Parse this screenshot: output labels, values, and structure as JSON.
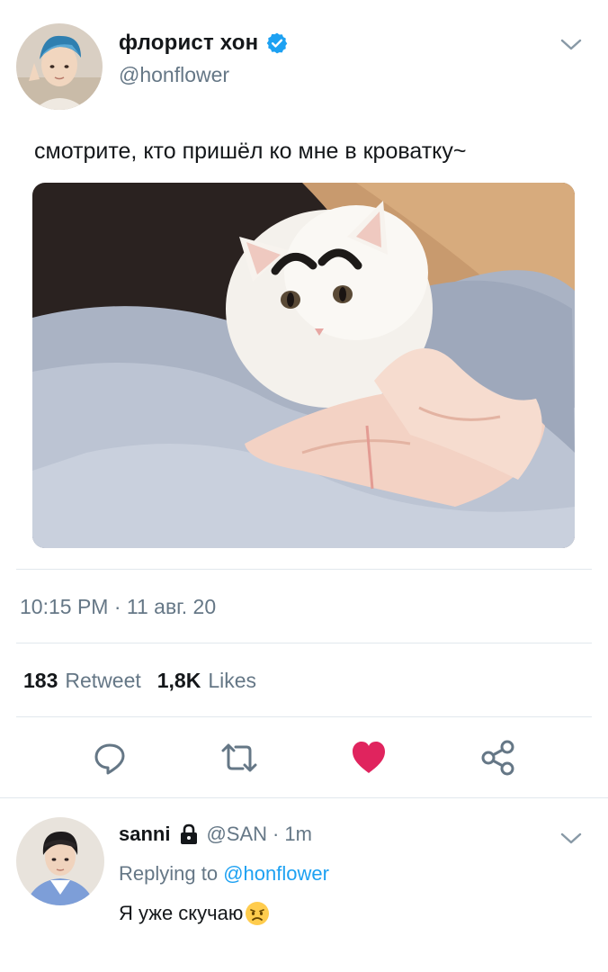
{
  "tweet": {
    "author": {
      "display_name": "флорист хон",
      "handle": "@honflower",
      "verified": true
    },
    "text": "смотрите, кто пришёл ко мне в кроватку~",
    "media_icon": "photo-cat-on-bed",
    "timestamp": "10:15 PM · 11 авг. 20",
    "stats": {
      "retweets_count": "183",
      "retweets_label": "Retweet",
      "likes_count": "1,8K",
      "likes_label": "Likes"
    },
    "actions": [
      {
        "name": "reply",
        "icon": "comment-icon"
      },
      {
        "name": "retweet",
        "icon": "retweet-icon"
      },
      {
        "name": "like",
        "icon": "heart-icon",
        "active": true
      },
      {
        "name": "share",
        "icon": "share-icon"
      }
    ]
  },
  "reply": {
    "display_name": "sanni",
    "locked": true,
    "handle": "@SAN",
    "separator": "·",
    "time": "1m",
    "replying_prefix": "Replying to",
    "replying_to": "@honflower",
    "text": "Я уже скучаю",
    "emoji": "disappointed-face"
  },
  "colors": {
    "primary_text": "#14171a",
    "secondary_text": "#657786",
    "accent_blue": "#1da1f2",
    "like_red": "#e0245e",
    "divider": "#e1e8ed"
  }
}
